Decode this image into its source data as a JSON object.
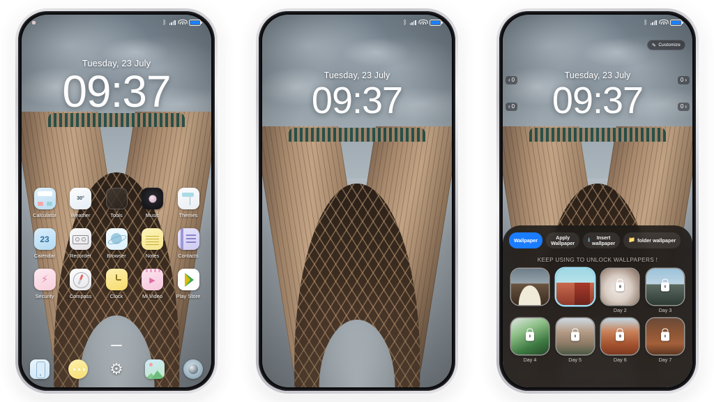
{
  "status_bar": {
    "icons": [
      "bluetooth-icon",
      "signal-icon",
      "wifi-icon",
      "battery-icon"
    ],
    "bluetooth_glyph": "ᛒ",
    "battery_color": "#1b7fff"
  },
  "lock_screen": {
    "date": "Tuesday, 23 July",
    "time": "09:37"
  },
  "phone1": {
    "label": "home-screen",
    "rows": [
      [
        {
          "name": "Calculator",
          "icon": "calculator-icon"
        },
        {
          "name": "Weather",
          "icon": "weather-icon",
          "value": "30°"
        },
        {
          "name": "Tools",
          "icon": "folder-tools-icon"
        },
        {
          "name": "Music",
          "icon": "music-icon"
        },
        {
          "name": "Themes",
          "icon": "themes-icon"
        }
      ],
      [
        {
          "name": "Calendar",
          "icon": "calendar-icon",
          "value": "23"
        },
        {
          "name": "Recorder",
          "icon": "recorder-icon"
        },
        {
          "name": "Browser",
          "icon": "browser-icon"
        },
        {
          "name": "Notes",
          "icon": "notes-icon"
        },
        {
          "name": "Contacts",
          "icon": "contacts-icon"
        }
      ],
      [
        {
          "name": "Security",
          "icon": "security-shield-icon"
        },
        {
          "name": "Compass",
          "icon": "compass-icon"
        },
        {
          "name": "Clock",
          "icon": "clock-icon"
        },
        {
          "name": "Mi Video",
          "icon": "video-icon"
        },
        {
          "name": "Play Store",
          "icon": "play-store-icon"
        }
      ]
    ],
    "dock": [
      {
        "name": "Phone",
        "icon": "phone-icon"
      },
      {
        "name": "Messages",
        "icon": "messages-icon"
      },
      {
        "name": "Settings",
        "icon": "gear-icon"
      },
      {
        "name": "Gallery",
        "icon": "gallery-icon"
      },
      {
        "name": "Camera",
        "icon": "camera-icon"
      }
    ]
  },
  "phone3": {
    "customize": {
      "label": "Customize",
      "icon": "pencil-icon"
    },
    "side_widgets": [
      {
        "side": "left",
        "label": "0",
        "chevron": "‹"
      },
      {
        "side": "left",
        "label": "0",
        "chevron": "‹"
      },
      {
        "side": "right",
        "label": "0",
        "chevron": "›"
      },
      {
        "side": "right",
        "label": "0",
        "chevron": "›"
      }
    ],
    "panel": {
      "tabs": [
        {
          "label": "Wallpaper",
          "active": true,
          "icon": null
        },
        {
          "label_line1": "Apply",
          "label_line2": "Wallpaper",
          "active": false,
          "icon": null
        },
        {
          "label_line1": "Insert",
          "label_line2": "wallpaper",
          "active": false,
          "icon": "download-icon"
        },
        {
          "label": "folder wallpaper",
          "active": false,
          "icon": "folder-icon"
        }
      ],
      "hint": "KEEP USING TO UNLOCK WALLPAPERS !",
      "accent_color": "#1a7cff",
      "grid": [
        [
          {
            "label": "",
            "locked": false,
            "selected": false,
            "art": "th-tower",
            "alt": "azadi-tower"
          },
          {
            "label": "",
            "locked": false,
            "selected": true,
            "art": "th-building",
            "alt": "red-building"
          },
          {
            "label": "Day 2",
            "locked": true,
            "selected": false,
            "art": "th-cat",
            "alt": "white-cat"
          },
          {
            "label": "Day 3",
            "locked": true,
            "selected": false,
            "art": "th-car",
            "alt": "road-vehicle"
          }
        ],
        [
          {
            "label": "Day 4",
            "locked": true,
            "selected": false,
            "art": "th-leaf",
            "alt": "green-leaves"
          },
          {
            "label": "Day 5",
            "locked": true,
            "selected": false,
            "art": "th-mtn",
            "alt": "mountain"
          },
          {
            "label": "Day 6",
            "locked": true,
            "selected": false,
            "art": "th-rock",
            "alt": "red-rock"
          },
          {
            "label": "Day 7",
            "locked": true,
            "selected": false,
            "art": "th-desert",
            "alt": "desert"
          }
        ]
      ]
    }
  }
}
